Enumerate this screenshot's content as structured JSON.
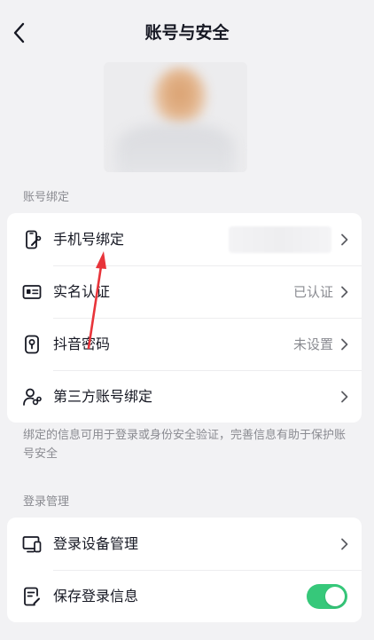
{
  "header": {
    "title": "账号与安全"
  },
  "binding_section": {
    "title": "账号绑定",
    "items": [
      {
        "label": "手机号绑定",
        "value": ""
      },
      {
        "label": "实名认证",
        "value": "已认证"
      },
      {
        "label": "抖音密码",
        "value": "未设置"
      },
      {
        "label": "第三方账号绑定",
        "value": ""
      }
    ],
    "note": "绑定的信息可用于登录或身份安全验证，完善信息有助于保护账号安全"
  },
  "login_section": {
    "title": "登录管理",
    "items": [
      {
        "label": "登录设备管理"
      },
      {
        "label": "保存登录信息",
        "toggle_on": true
      }
    ]
  },
  "colors": {
    "background": "#f2f2f4",
    "card": "#ffffff",
    "text_primary": "#161823",
    "text_secondary": "#8a8b91",
    "toggle_on": "#36c87a",
    "annotation_arrow": "#e8343a"
  }
}
